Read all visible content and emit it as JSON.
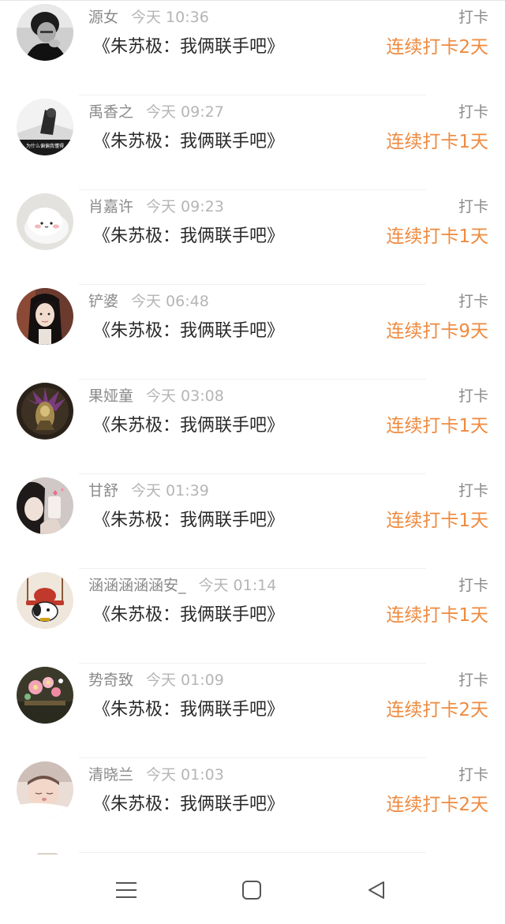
{
  "rows": [
    {
      "name": "源女",
      "time": "今天 10:36",
      "title": "《朱苏极：我俩联手吧》",
      "action": "打卡",
      "streak": "连续打卡2天",
      "avatar": "avatar-bw-boy"
    },
    {
      "name": "禹香之",
      "time": "今天 09:27",
      "title": "《朱苏极：我俩联手吧》",
      "action": "打卡",
      "streak": "连续打卡1天",
      "avatar": "avatar-bw-caption"
    },
    {
      "name": "肖嘉许",
      "time": "今天 09:23",
      "title": "《朱苏极：我俩联手吧》",
      "action": "打卡",
      "streak": "连续打卡1天",
      "avatar": "avatar-mochi"
    },
    {
      "name": "铲婆",
      "time": "今天 06:48",
      "title": "《朱苏极：我俩联手吧》",
      "action": "打卡",
      "streak": "连续打卡9天",
      "avatar": "avatar-girl-portrait"
    },
    {
      "name": "果娅童",
      "time": "今天 03:08",
      "title": "《朱苏极：我俩联手吧》",
      "action": "打卡",
      "streak": "连续打卡1天",
      "avatar": "avatar-dark-creature"
    },
    {
      "name": "甘舒",
      "time": "今天 01:39",
      "title": "《朱苏极：我俩联手吧》",
      "action": "打卡",
      "streak": "连续打卡1天",
      "avatar": "avatar-selfie-girl"
    },
    {
      "name": "涵涵涵涵涵安_",
      "time": "今天 01:14",
      "title": "《朱苏极：我俩联手吧》",
      "action": "打卡",
      "streak": "连续打卡1天",
      "avatar": "avatar-cartoon-dog"
    },
    {
      "name": "势奇致",
      "time": "今天 01:09",
      "title": "《朱苏极：我俩联手吧》",
      "action": "打卡",
      "streak": "连续打卡2天",
      "avatar": "avatar-flower-hairpin"
    },
    {
      "name": "清晓兰",
      "time": "今天 01:03",
      "title": "《朱苏极：我俩联手吧》",
      "action": "打卡",
      "streak": "连续打卡2天",
      "avatar": "avatar-sleeping-baby"
    }
  ],
  "avatar2_caption": "为什么偏偏我懂得",
  "nav": {
    "menu_icon": "menu-icon",
    "home_icon": "home-square-icon",
    "back_icon": "back-triangle-icon"
  },
  "colors": {
    "streak": "#ef8a3f",
    "name": "#8a8a8a",
    "time": "#b5b5b5",
    "title": "#2a2a2a"
  }
}
